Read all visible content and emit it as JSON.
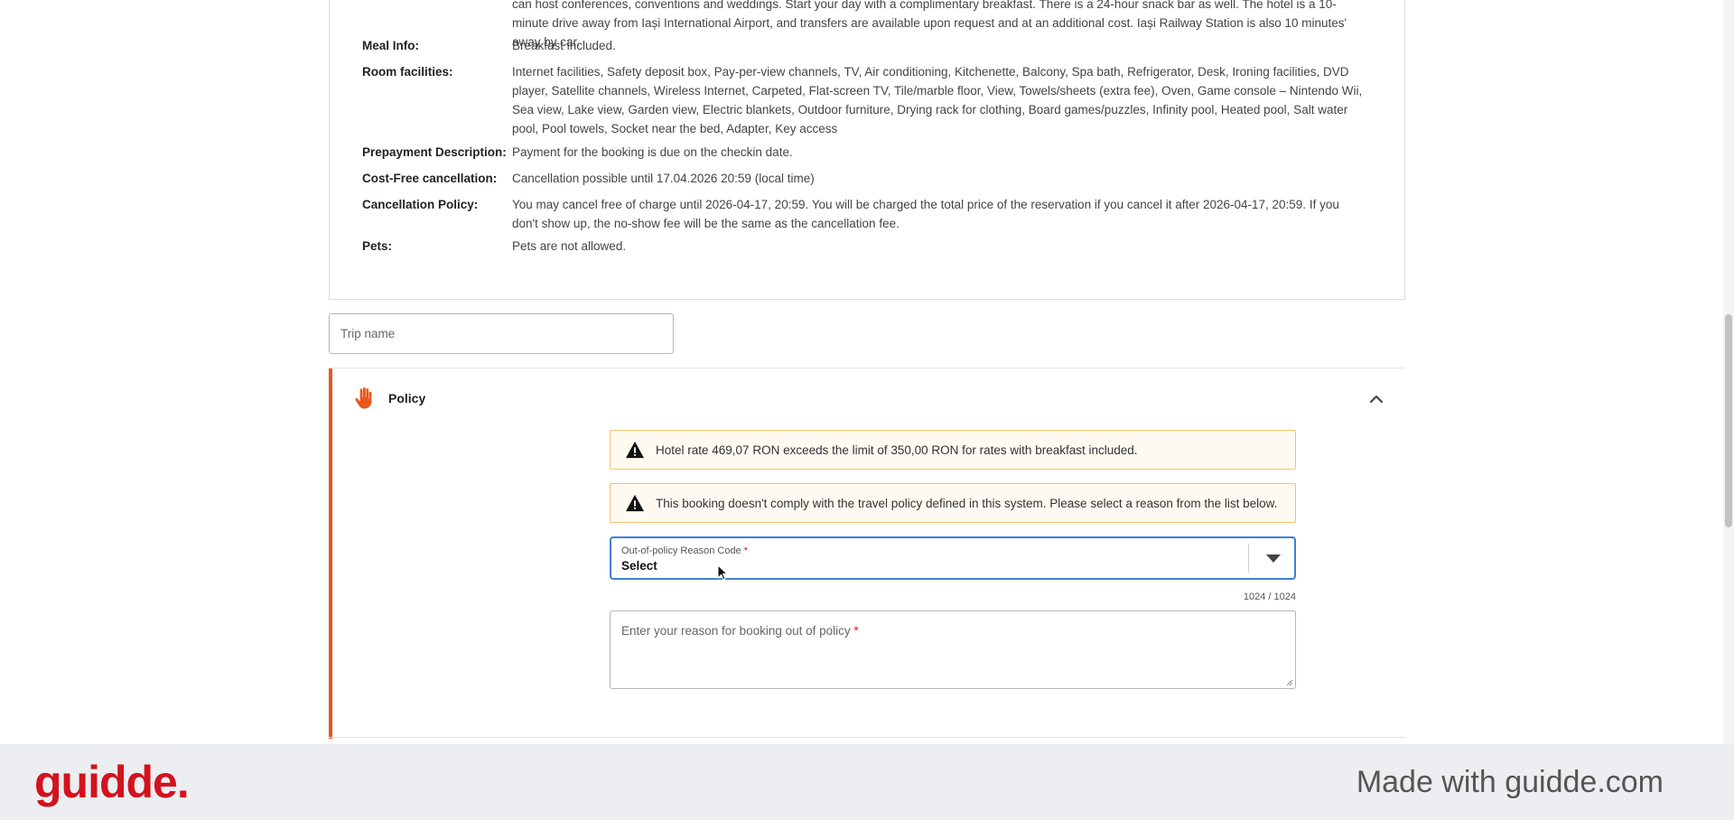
{
  "details": [
    {
      "label": "",
      "value": "can host conferences, conventions and weddings. Start your day with a complimentary breakfast. There is a 24-hour snack bar as well. The hotel is a 10-minute drive away from Iași International Airport, and transfers are available upon request and at an additional cost. Iași Railway Station is also 10 minutes' away by car."
    },
    {
      "label": "Meal Info:",
      "value": "Breakfast included."
    },
    {
      "label": "Room facilities:",
      "value": "Internet facilities, Safety deposit box, Pay-per-view channels, TV, Air conditioning, Kitchenette, Balcony, Spa bath, Refrigerator, Desk, Ironing facilities, DVD player, Satellite channels, Wireless Internet, Carpeted, Flat-screen TV, Tile/marble floor, View, Towels/sheets (extra fee), Oven, Game console – Nintendo Wii, Sea view, Lake view, Garden view, Electric blankets, Outdoor furniture, Drying rack for clothing, Board games/puzzles, Infinity pool, Heated pool, Salt water pool, Pool towels, Socket near the bed, Adapter, Key access"
    },
    {
      "label": "Prepayment Description:",
      "value": "Payment for the booking is due on the checkin date."
    },
    {
      "label": "Cost-Free cancellation:",
      "value": "Cancellation possible until 17.04.2026 20:59 (local time)"
    },
    {
      "label": "Cancellation Policy:",
      "value": "You may cancel free of charge until 2026-04-17, 20:59. You will be charged the total price of the reservation if you cancel it after 2026-04-17, 20:59. If you don't show up, the no-show fee will be the same as the cancellation fee."
    },
    {
      "label": "Pets:",
      "value": "Pets are not allowed."
    }
  ],
  "trip_name": {
    "placeholder": "Trip name",
    "value": ""
  },
  "policy": {
    "title": "Policy",
    "alerts": [
      "Hotel rate 469,07 RON exceeds the limit of 350,00 RON for rates with breakfast included.",
      "This booking doesn't comply with the travel policy defined in this system. Please select a reason from the list below."
    ],
    "reason_code": {
      "label": "Out-of-policy Reason Code",
      "required_mark": "*",
      "selected": "Select"
    },
    "char_count": "1024 / 1024",
    "reason_text": {
      "placeholder": "Enter your reason for booking out of policy",
      "required_mark": "*"
    }
  },
  "colors": {
    "accent": "#e8581c",
    "focus": "#3b82d8",
    "warning_border": "#f2c46a",
    "brand": "#d3121d"
  },
  "icons": {
    "policy": "hand-stop-icon",
    "collapse": "chevron-up-icon",
    "alert": "warning-triangle-icon",
    "dropdown": "caret-down-icon"
  },
  "footer": {
    "logo": "guidde.",
    "text": "Made with guidde.com"
  }
}
